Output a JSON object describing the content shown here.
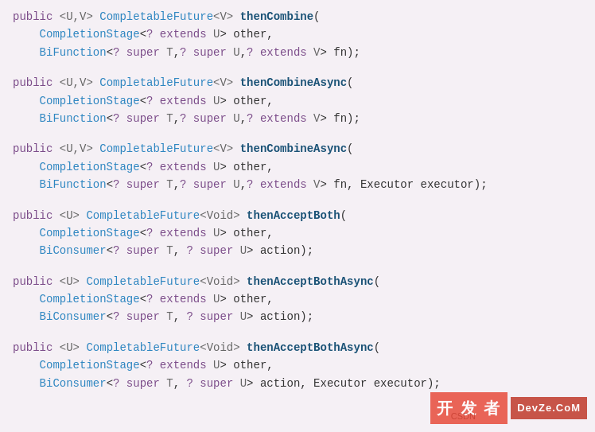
{
  "code_blocks": [
    {
      "id": "block1",
      "lines": [
        {
          "parts": [
            {
              "text": "public ",
              "class": "kw"
            },
            {
              "text": "<U,V>",
              "class": "generic"
            },
            {
              "text": " CompletableFuture",
              "class": "type"
            },
            {
              "text": "<V>",
              "class": "generic"
            },
            {
              "text": " ",
              "class": "punct"
            },
            {
              "text": "thenCombine",
              "class": "method"
            },
            {
              "text": "(",
              "class": "punct"
            }
          ]
        },
        {
          "parts": [
            {
              "text": "    CompletionStage",
              "class": "type"
            },
            {
              "text": "<",
              "class": "punct"
            },
            {
              "text": "?",
              "class": "kw"
            },
            {
              "text": " extends ",
              "class": "kw"
            },
            {
              "text": "U",
              "class": "generic"
            },
            {
              "text": "> other,",
              "class": "punct"
            }
          ]
        },
        {
          "parts": [
            {
              "text": "    BiFunction",
              "class": "type"
            },
            {
              "text": "<",
              "class": "punct"
            },
            {
              "text": "? super ",
              "class": "kw"
            },
            {
              "text": "T",
              "class": "generic"
            },
            {
              "text": ",",
              "class": "punct"
            },
            {
              "text": "? super ",
              "class": "kw"
            },
            {
              "text": "U",
              "class": "generic"
            },
            {
              "text": ",",
              "class": "punct"
            },
            {
              "text": "? extends ",
              "class": "kw"
            },
            {
              "text": "V",
              "class": "generic"
            },
            {
              "text": "> fn);",
              "class": "punct"
            }
          ]
        }
      ]
    },
    {
      "id": "block2",
      "lines": [
        {
          "parts": [
            {
              "text": "public ",
              "class": "kw"
            },
            {
              "text": "<U,V>",
              "class": "generic"
            },
            {
              "text": " CompletableFuture",
              "class": "type"
            },
            {
              "text": "<V>",
              "class": "generic"
            },
            {
              "text": " ",
              "class": "punct"
            },
            {
              "text": "thenCombineAsync",
              "class": "method"
            },
            {
              "text": "(",
              "class": "punct"
            }
          ]
        },
        {
          "parts": [
            {
              "text": "    CompletionStage",
              "class": "type"
            },
            {
              "text": "<",
              "class": "punct"
            },
            {
              "text": "?",
              "class": "kw"
            },
            {
              "text": " extends ",
              "class": "kw"
            },
            {
              "text": "U",
              "class": "generic"
            },
            {
              "text": "> other,",
              "class": "punct"
            }
          ]
        },
        {
          "parts": [
            {
              "text": "    BiFunction",
              "class": "type"
            },
            {
              "text": "<",
              "class": "punct"
            },
            {
              "text": "? super ",
              "class": "kw"
            },
            {
              "text": "T",
              "class": "generic"
            },
            {
              "text": ",",
              "class": "punct"
            },
            {
              "text": "? super ",
              "class": "kw"
            },
            {
              "text": "U",
              "class": "generic"
            },
            {
              "text": ",",
              "class": "punct"
            },
            {
              "text": "? extends ",
              "class": "kw"
            },
            {
              "text": "V",
              "class": "generic"
            },
            {
              "text": "> fn);",
              "class": "punct"
            }
          ]
        }
      ]
    },
    {
      "id": "block3",
      "lines": [
        {
          "parts": [
            {
              "text": "public ",
              "class": "kw"
            },
            {
              "text": "<U,V>",
              "class": "generic"
            },
            {
              "text": " CompletableFuture",
              "class": "type"
            },
            {
              "text": "<V>",
              "class": "generic"
            },
            {
              "text": " ",
              "class": "punct"
            },
            {
              "text": "thenCombineAsync",
              "class": "method"
            },
            {
              "text": "(",
              "class": "punct"
            }
          ]
        },
        {
          "parts": [
            {
              "text": "    CompletionStage",
              "class": "type"
            },
            {
              "text": "<",
              "class": "punct"
            },
            {
              "text": "?",
              "class": "kw"
            },
            {
              "text": " extends ",
              "class": "kw"
            },
            {
              "text": "U",
              "class": "generic"
            },
            {
              "text": "> other,",
              "class": "punct"
            }
          ]
        },
        {
          "parts": [
            {
              "text": "    BiFunction",
              "class": "type"
            },
            {
              "text": "<",
              "class": "punct"
            },
            {
              "text": "? super ",
              "class": "kw"
            },
            {
              "text": "T",
              "class": "generic"
            },
            {
              "text": ",",
              "class": "punct"
            },
            {
              "text": "? super ",
              "class": "kw"
            },
            {
              "text": "U",
              "class": "generic"
            },
            {
              "text": ",",
              "class": "punct"
            },
            {
              "text": "? extends ",
              "class": "kw"
            },
            {
              "text": "V",
              "class": "generic"
            },
            {
              "text": "> fn, Executor executor);",
              "class": "punct"
            }
          ]
        }
      ]
    },
    {
      "id": "block4",
      "lines": [
        {
          "parts": [
            {
              "text": "public ",
              "class": "kw"
            },
            {
              "text": "<U>",
              "class": "generic"
            },
            {
              "text": " CompletableFuture",
              "class": "type"
            },
            {
              "text": "<Void>",
              "class": "generic"
            },
            {
              "text": " ",
              "class": "punct"
            },
            {
              "text": "thenAcceptBoth",
              "class": "method"
            },
            {
              "text": "(",
              "class": "punct"
            }
          ]
        },
        {
          "parts": [
            {
              "text": "    CompletionStage",
              "class": "type"
            },
            {
              "text": "<",
              "class": "punct"
            },
            {
              "text": "?",
              "class": "kw"
            },
            {
              "text": " extends ",
              "class": "kw"
            },
            {
              "text": "U",
              "class": "generic"
            },
            {
              "text": "> other,",
              "class": "punct"
            }
          ]
        },
        {
          "parts": [
            {
              "text": "    BiConsumer",
              "class": "type"
            },
            {
              "text": "<",
              "class": "punct"
            },
            {
              "text": "? super ",
              "class": "kw"
            },
            {
              "text": "T",
              "class": "generic"
            },
            {
              "text": ", ",
              "class": "punct"
            },
            {
              "text": "? super ",
              "class": "kw"
            },
            {
              "text": "U",
              "class": "generic"
            },
            {
              "text": "> action);",
              "class": "punct"
            }
          ]
        }
      ]
    },
    {
      "id": "block5",
      "lines": [
        {
          "parts": [
            {
              "text": "public ",
              "class": "kw"
            },
            {
              "text": "<U>",
              "class": "generic"
            },
            {
              "text": " CompletableFuture",
              "class": "type"
            },
            {
              "text": "<Void>",
              "class": "generic"
            },
            {
              "text": " ",
              "class": "punct"
            },
            {
              "text": "thenAcceptBothAsync",
              "class": "method"
            },
            {
              "text": "(",
              "class": "punct"
            }
          ]
        },
        {
          "parts": [
            {
              "text": "    CompletionStage",
              "class": "type"
            },
            {
              "text": "<",
              "class": "punct"
            },
            {
              "text": "?",
              "class": "kw"
            },
            {
              "text": " extends ",
              "class": "kw"
            },
            {
              "text": "U",
              "class": "generic"
            },
            {
              "text": "> other,",
              "class": "punct"
            }
          ]
        },
        {
          "parts": [
            {
              "text": "    BiConsumer",
              "class": "type"
            },
            {
              "text": "<",
              "class": "punct"
            },
            {
              "text": "? super ",
              "class": "kw"
            },
            {
              "text": "T",
              "class": "generic"
            },
            {
              "text": ", ",
              "class": "punct"
            },
            {
              "text": "? super ",
              "class": "kw"
            },
            {
              "text": "U",
              "class": "generic"
            },
            {
              "text": "> action);",
              "class": "punct"
            }
          ]
        }
      ]
    },
    {
      "id": "block6",
      "lines": [
        {
          "parts": [
            {
              "text": "public ",
              "class": "kw"
            },
            {
              "text": "<U>",
              "class": "generic"
            },
            {
              "text": " CompletableFuture",
              "class": "type"
            },
            {
              "text": "<Void>",
              "class": "generic"
            },
            {
              "text": " ",
              "class": "punct"
            },
            {
              "text": "thenAcceptBothAsync",
              "class": "method"
            },
            {
              "text": "(",
              "class": "punct"
            }
          ]
        },
        {
          "parts": [
            {
              "text": "    CompletionStage",
              "class": "type"
            },
            {
              "text": "<",
              "class": "punct"
            },
            {
              "text": "?",
              "class": "kw"
            },
            {
              "text": " extends ",
              "class": "kw"
            },
            {
              "text": "U",
              "class": "generic"
            },
            {
              "text": "> other,",
              "class": "punct"
            }
          ]
        },
        {
          "parts": [
            {
              "text": "    BiConsumer",
              "class": "type"
            },
            {
              "text": "<",
              "class": "punct"
            },
            {
              "text": "? super ",
              "class": "kw"
            },
            {
              "text": "T",
              "class": "generic"
            },
            {
              "text": ", ",
              "class": "punct"
            },
            {
              "text": "? super ",
              "class": "kw"
            },
            {
              "text": "U",
              "class": "generic"
            },
            {
              "text": "> action, Executor executor);",
              "class": "punct"
            }
          ]
        }
      ]
    }
  ],
  "watermark": {
    "left_text": "开 发 者",
    "right_text": "DevZe.CoM",
    "csdn_text": "CSDN"
  }
}
